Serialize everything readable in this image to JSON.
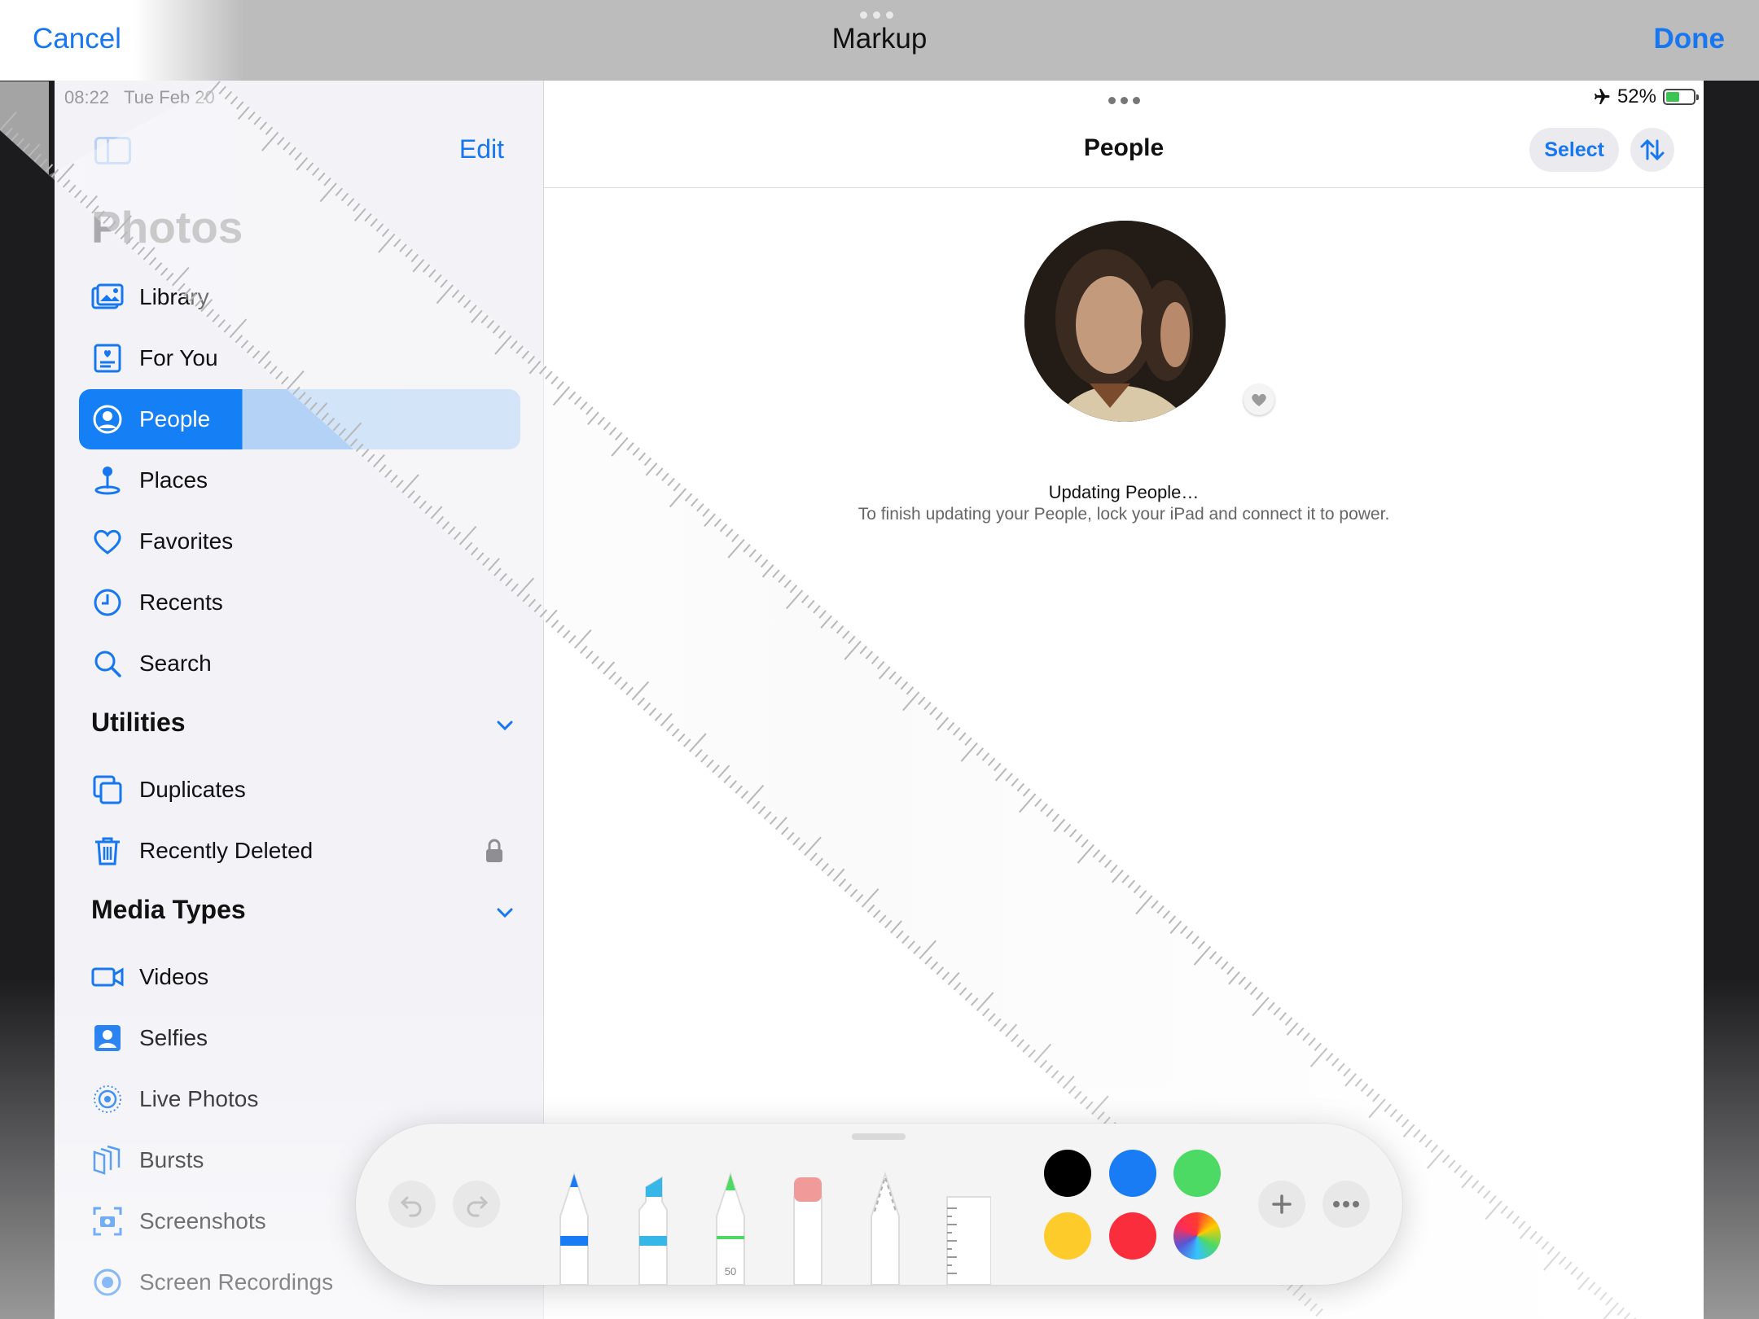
{
  "markup": {
    "cancel": "Cancel",
    "title": "Markup",
    "done": "Done"
  },
  "sidebar": {
    "time": "08:22",
    "date": "Tue Feb 20",
    "edit": "Edit",
    "title": "Photos",
    "items": [
      {
        "label": "Library",
        "icon": "photo-library-icon"
      },
      {
        "label": "For You",
        "icon": "for-you-icon"
      },
      {
        "label": "People",
        "icon": "person-circle-icon",
        "selected": true
      },
      {
        "label": "Places",
        "icon": "map-pin-icon"
      },
      {
        "label": "Favorites",
        "icon": "heart-icon"
      },
      {
        "label": "Recents",
        "icon": "clock-icon"
      },
      {
        "label": "Search",
        "icon": "search-icon"
      }
    ],
    "utilities": {
      "title": "Utilities",
      "items": [
        {
          "label": "Duplicates",
          "icon": "duplicates-icon"
        },
        {
          "label": "Recently Deleted",
          "icon": "trash-icon",
          "locked": true
        }
      ]
    },
    "media_types": {
      "title": "Media Types",
      "items": [
        {
          "label": "Videos",
          "icon": "video-icon"
        },
        {
          "label": "Selfies",
          "icon": "selfie-icon"
        },
        {
          "label": "Live Photos",
          "icon": "live-photo-icon"
        },
        {
          "label": "Bursts",
          "icon": "bursts-icon"
        },
        {
          "label": "Screenshots",
          "icon": "screenshot-icon"
        },
        {
          "label": "Screen Recordings",
          "icon": "screen-recording-icon"
        }
      ]
    }
  },
  "main": {
    "battery": "52%",
    "title": "People",
    "select": "Select",
    "updating_title": "Updating People…",
    "updating_subtitle": "To finish updating your People, lock your iPad and connect it to power."
  },
  "palette": {
    "marker_width_label": "50",
    "colors": [
      "#000000",
      "#1a7cf5",
      "#4cd964",
      "#fdcc2a",
      "#fa2d3c"
    ]
  }
}
